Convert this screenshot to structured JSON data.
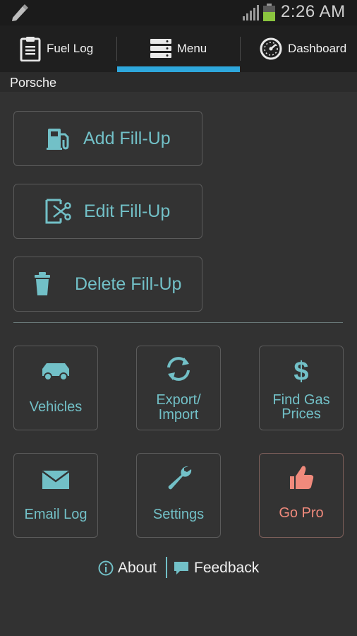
{
  "status_bar": {
    "time": "2:26 AM",
    "icons": [
      "pencil-icon",
      "signal-icon",
      "battery-icon"
    ]
  },
  "tabs": [
    {
      "label": "Fuel Log",
      "icon": "clipboard-icon",
      "selected": false
    },
    {
      "label": "Menu",
      "icon": "menu-list-icon",
      "selected": true
    },
    {
      "label": "Dashboard",
      "icon": "speedometer-icon",
      "selected": false
    }
  ],
  "vehicle": {
    "name": "Porsche"
  },
  "actions": [
    {
      "label": "Add Fill-Up",
      "icon": "fuel-pump-icon"
    },
    {
      "label": "Edit Fill-Up",
      "icon": "edit-scissors-icon"
    },
    {
      "label": "Delete Fill-Up",
      "icon": "trash-icon"
    }
  ],
  "grid": {
    "vehicles": {
      "label": "Vehicles",
      "icon": "car-icon"
    },
    "export_import": {
      "line1": "Export/",
      "line2": "Import",
      "icon": "sync-icon"
    },
    "find_gas": {
      "line1": "Find Gas",
      "line2": "Prices",
      "icon": "dollar-icon"
    },
    "email_log": {
      "label": "Email Log",
      "icon": "envelope-icon"
    },
    "settings": {
      "label": "Settings",
      "icon": "wrench-icon"
    },
    "go_pro": {
      "label": "Go Pro",
      "icon": "thumbs-up-icon"
    }
  },
  "footer": {
    "about": "About",
    "feedback": "Feedback"
  },
  "colors": {
    "accent": "#72c0c7",
    "tab_indicator": "#2ea7dc",
    "pro": "#f08a7c",
    "background": "#323232",
    "battery": "#8bc53f"
  }
}
